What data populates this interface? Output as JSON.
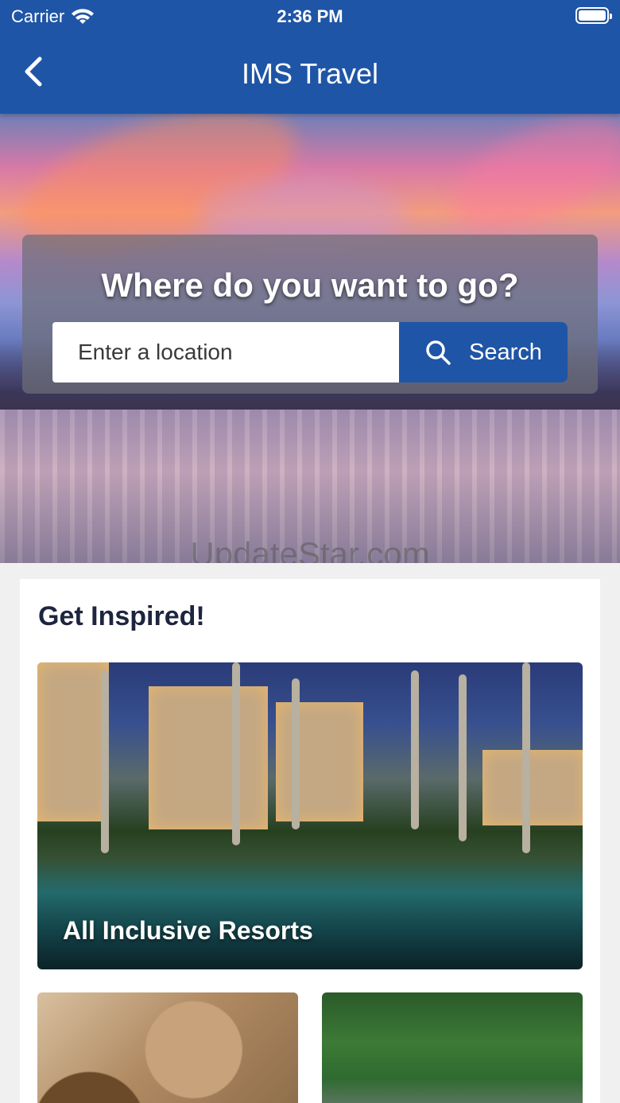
{
  "status_bar": {
    "carrier": "Carrier",
    "time": "2:36 PM",
    "battery": 1.0
  },
  "nav": {
    "title": "IMS Travel",
    "back_icon": "chevron-left-icon"
  },
  "hero": {
    "headline": "Where do you want to go?",
    "search": {
      "placeholder": "Enter a location",
      "value": "",
      "button_label": "Search",
      "button_icon": "search-icon"
    },
    "watermark": "UpdateStar.com"
  },
  "inspire": {
    "title": "Get Inspired!",
    "tiles": [
      {
        "label": "All Inclusive Resorts"
      }
    ]
  },
  "colors": {
    "brand_blue": "#1f55a6",
    "heading_text": "#1d2540",
    "page_bg": "#f0f0f0"
  }
}
